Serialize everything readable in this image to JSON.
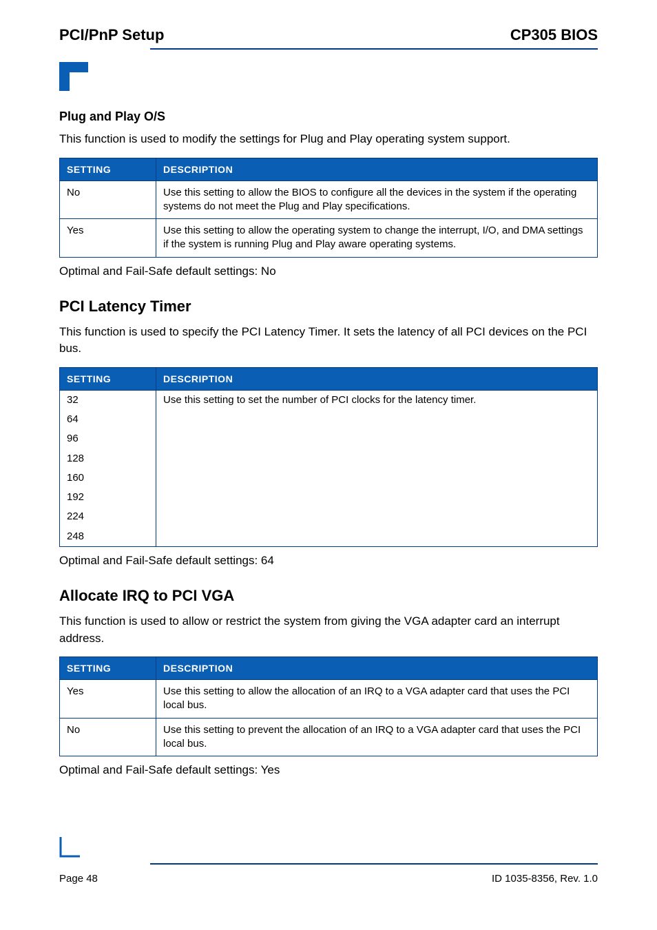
{
  "header": {
    "left": "PCI/PnP Setup",
    "right": "CP305 BIOS"
  },
  "section_pnp": {
    "heading": "Plug and Play O/S",
    "para": "This function is used to modify the settings for Plug and Play operating system support.",
    "table": {
      "col_setting": "SETTING",
      "col_description": "DESCRIPTION",
      "rows": [
        {
          "setting": "No",
          "description": "Use this setting to allow the BIOS to configure all the devices in the system if the operating systems do not meet the Plug and Play specifications."
        },
        {
          "setting": "Yes",
          "description": "Use this setting to allow the operating system to change the interrupt, I/O, and DMA settings if the system is running Plug and Play aware operating systems."
        }
      ]
    },
    "after": "Optimal and Fail-Safe default settings: No"
  },
  "section_latency": {
    "heading": "PCI Latency Timer",
    "para": "This function is used to specify the PCI Latency Timer. It sets the latency of all PCI devices on the PCI bus.",
    "table": {
      "col_setting": "SETTING",
      "col_description": "DESCRIPTION",
      "settings": [
        "32",
        "64",
        "96",
        "128",
        "160",
        "192",
        "224",
        "248"
      ],
      "description": "Use this setting to set the number of PCI clocks for the latency timer."
    },
    "after": "Optimal and Fail-Safe default settings: 64"
  },
  "section_irq": {
    "heading": "Allocate IRQ to PCI VGA",
    "para": "This function is used to allow or restrict the system from giving the VGA adapter card an interrupt address.",
    "table": {
      "col_setting": "SETTING",
      "col_description": "DESCRIPTION",
      "rows": [
        {
          "setting": "Yes",
          "description": "Use this setting to allow the allocation of an IRQ to a VGA adapter card that uses the PCI local bus."
        },
        {
          "setting": "No",
          "description": "Use this setting to prevent the allocation of an IRQ to a VGA adapter card that uses the PCI local bus."
        }
      ]
    },
    "after": "Optimal and Fail-Safe default settings: Yes"
  },
  "footer": {
    "page": "Page 48",
    "docid": "ID 1035-8356, Rev. 1.0"
  }
}
